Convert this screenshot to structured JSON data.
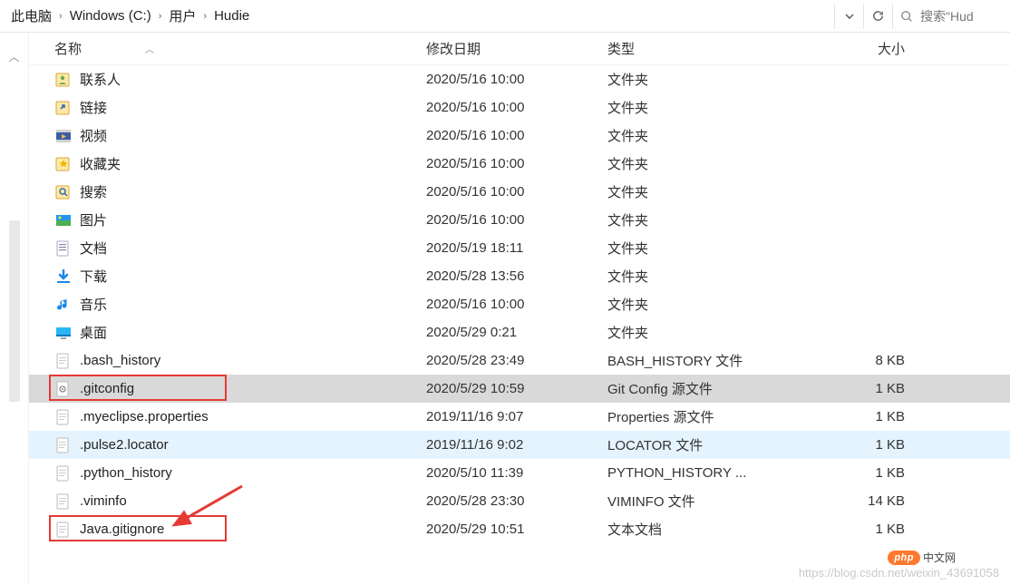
{
  "breadcrumb": [
    "此电脑",
    "Windows (C:)",
    "用户",
    "Hudie"
  ],
  "search_placeholder": "搜索\"Hud",
  "columns": {
    "name": "名称",
    "date": "修改日期",
    "type": "类型",
    "size": "大小"
  },
  "rows": [
    {
      "icon": "contacts",
      "name": "联系人",
      "date": "2020/5/16 10:00",
      "type": "文件夹",
      "size": ""
    },
    {
      "icon": "links",
      "name": "链接",
      "date": "2020/5/16 10:00",
      "type": "文件夹",
      "size": ""
    },
    {
      "icon": "video",
      "name": "视频",
      "date": "2020/5/16 10:00",
      "type": "文件夹",
      "size": ""
    },
    {
      "icon": "favorites",
      "name": "收藏夹",
      "date": "2020/5/16 10:00",
      "type": "文件夹",
      "size": ""
    },
    {
      "icon": "search",
      "name": "搜索",
      "date": "2020/5/16 10:00",
      "type": "文件夹",
      "size": ""
    },
    {
      "icon": "pictures",
      "name": "图片",
      "date": "2020/5/16 10:00",
      "type": "文件夹",
      "size": ""
    },
    {
      "icon": "docfolder",
      "name": "文档",
      "date": "2020/5/19 18:11",
      "type": "文件夹",
      "size": ""
    },
    {
      "icon": "downloads",
      "name": "下载",
      "date": "2020/5/28 13:56",
      "type": "文件夹",
      "size": ""
    },
    {
      "icon": "music",
      "name": "音乐",
      "date": "2020/5/16 10:00",
      "type": "文件夹",
      "size": ""
    },
    {
      "icon": "desktop",
      "name": "桌面",
      "date": "2020/5/29 0:21",
      "type": "文件夹",
      "size": ""
    },
    {
      "icon": "file",
      "name": ".bash_history",
      "date": "2020/5/28 23:49",
      "type": "BASH_HISTORY 文件",
      "size": "8 KB"
    },
    {
      "icon": "gear",
      "name": ".gitconfig",
      "date": "2020/5/29 10:59",
      "type": "Git Config 源文件",
      "size": "1 KB",
      "selected": true,
      "highlight": true
    },
    {
      "icon": "file",
      "name": ".myeclipse.properties",
      "date": "2019/11/16 9:07",
      "type": "Properties 源文件",
      "size": "1 KB"
    },
    {
      "icon": "file",
      "name": ".pulse2.locator",
      "date": "2019/11/16 9:02",
      "type": "LOCATOR 文件",
      "size": "1 KB",
      "hover": true
    },
    {
      "icon": "file",
      "name": ".python_history",
      "date": "2020/5/10 11:39",
      "type": "PYTHON_HISTORY ...",
      "size": "1 KB"
    },
    {
      "icon": "file",
      "name": ".viminfo",
      "date": "2020/5/28 23:30",
      "type": "VIMINFO 文件",
      "size": "14 KB"
    },
    {
      "icon": "file",
      "name": "Java.gitignore",
      "date": "2020/5/29 10:51",
      "type": "文本文档",
      "size": "1 KB",
      "highlight": true
    }
  ],
  "watermark": "https://blog.csdn.net/weixin_43691058",
  "badge": {
    "pill": "php",
    "text": "中文网"
  }
}
